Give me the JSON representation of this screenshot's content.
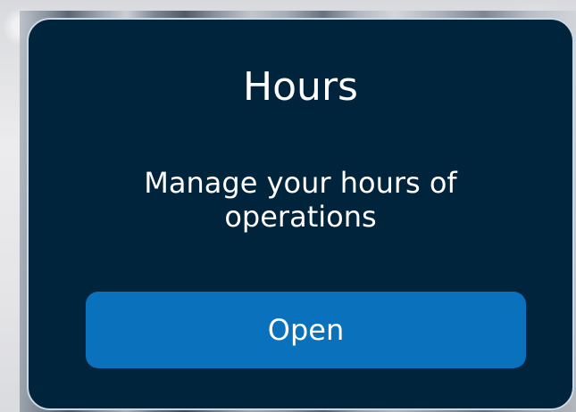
{
  "card": {
    "title": "Hours",
    "description": "Manage your hours of operations",
    "open_label": "Open"
  },
  "colors": {
    "card_background": "#00243c",
    "button_background": "#0a72bd",
    "text": "#ffffff"
  }
}
